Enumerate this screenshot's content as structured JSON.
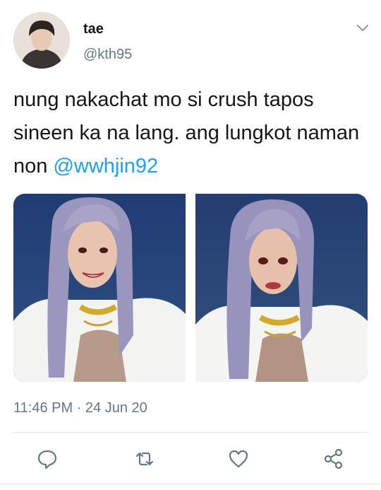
{
  "tweet": {
    "display_name": "tae",
    "handle": "@kth95",
    "text": "nung nakachat mo si crush tapos sineen ka na lang. ang lungkot naman non ",
    "mention": "@wwhjin92",
    "timestamp": "11:46 PM · 24 Jun 20"
  },
  "icons": {
    "caret": "chevron-down-icon",
    "reply": "comment-icon",
    "retweet": "retweet-icon",
    "like": "heart-icon",
    "share": "share-icon"
  },
  "colors": {
    "link": "#1da1f2",
    "muted": "#657786",
    "divider": "#e1e8ed"
  }
}
